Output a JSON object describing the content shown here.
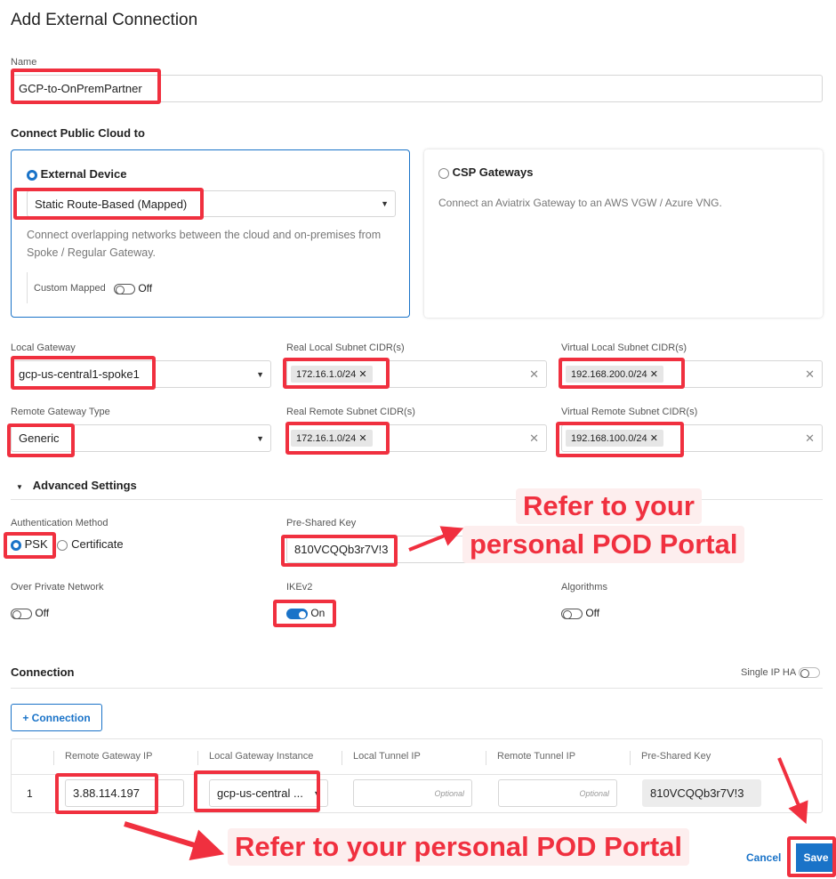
{
  "title": "Add External Connection",
  "name": {
    "label": "Name",
    "value": "GCP-to-OnPremPartner"
  },
  "connect": {
    "heading": "Connect Public Cloud to",
    "external": {
      "label": "External Device",
      "select": "Static Route-Based (Mapped)",
      "description": "Connect overlapping networks between the cloud and on-premises from Spoke / Regular Gateway.",
      "custom_label": "Custom Mapped",
      "custom_state": "Off",
      "selected": true
    },
    "csp": {
      "label": "CSP Gateways",
      "description": "Connect an Aviatrix Gateway to an AWS VGW / Azure VNG.",
      "selected": false
    }
  },
  "fields": {
    "local_gateway": {
      "label": "Local Gateway",
      "value": "gcp-us-central1-spoke1"
    },
    "real_local": {
      "label": "Real Local Subnet CIDR(s)",
      "tag": "172.16.1.0/24"
    },
    "virtual_local": {
      "label": "Virtual Local Subnet CIDR(s)",
      "tag": "192.168.200.0/24"
    },
    "remote_type": {
      "label": "Remote Gateway Type",
      "value": "Generic"
    },
    "real_remote": {
      "label": "Real Remote Subnet CIDR(s)",
      "tag": "172.16.1.0/24"
    },
    "virtual_remote": {
      "label": "Virtual Remote Subnet CIDR(s)",
      "tag": "192.168.100.0/24"
    }
  },
  "advanced": {
    "heading": "Advanced Settings",
    "auth_label": "Authentication Method",
    "psk": "PSK",
    "cert": "Certificate",
    "psk_label": "Pre-Shared Key",
    "psk_value": "810VCQQb3r7V!3",
    "private_label": "Over Private Network",
    "private_state": "Off",
    "ike_label": "IKEv2",
    "ike_state": "On",
    "alg_label": "Algorithms",
    "alg_state": "Off"
  },
  "connection": {
    "heading": "Connection",
    "single_ip": "Single IP HA",
    "add": "+ Connection",
    "columns": [
      "Remote Gateway IP",
      "Local Gateway Instance",
      "Local Tunnel IP",
      "Remote Tunnel IP",
      "Pre-Shared Key"
    ],
    "row": {
      "index": "1",
      "remote_ip": "3.88.114.197",
      "instance": "gcp-us-central ...",
      "local_tunnel": "Optional",
      "remote_tunnel": "Optional",
      "psk": "810VCQQb3r7V!3"
    }
  },
  "footer": {
    "cancel": "Cancel",
    "save": "Save"
  },
  "annotations": {
    "top_line1": "Refer to your",
    "top_line2": "personal POD Portal",
    "bottom": "Refer to your personal POD Portal"
  },
  "colors": {
    "accent": "#1a73c8",
    "annotation": "#f0303f"
  }
}
